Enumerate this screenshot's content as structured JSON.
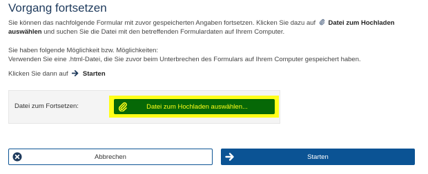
{
  "heading": "Vorgang fortsetzen",
  "intro": {
    "before": "Sie können das nachfolgende Formular mit zuvor gespeicherten Angaben fortsetzen. Klicken Sie dazu auf",
    "link_bold": "Datei zum Hochladen auswählen",
    "after": "und suchen Sie die Datei mit den betreffenden Formulardaten auf Ihrem Computer."
  },
  "options": {
    "line1": "Sie haben folgende Möglichkeit bzw. Möglichkeiten:",
    "line2": "Verwenden Sie eine .html-Datei, die Sie zuvor beim Unterbrechen des Formulars auf Ihrem Computer gespeichert haben."
  },
  "instruction": {
    "text": "Klicken Sie dann auf",
    "bold": "Starten"
  },
  "upload": {
    "label": "Datei zum Fortsetzen:",
    "button_label": "Datei zum Hochladen auswählen...",
    "button_icon": "paperclip-icon"
  },
  "actions": {
    "cancel_label": "Abbrechen",
    "cancel_icon": "close-circle-icon",
    "start_label": "Starten",
    "start_icon": "arrow-right-icon"
  },
  "colors": {
    "heading": "#1e3a5c",
    "primary": "#0b5394",
    "upload_button_bg": "#066806",
    "upload_button_text": "#ffff19",
    "highlight": "#ffff19"
  }
}
